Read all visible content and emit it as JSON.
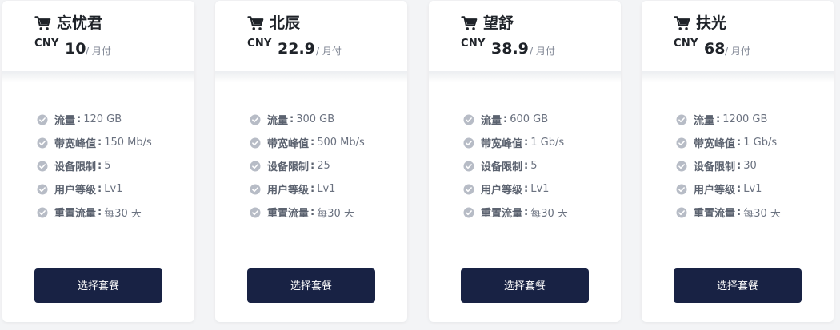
{
  "currency": "CNY",
  "period": "/ 月付",
  "button_label": "选择套餐",
  "feature_sep": ":",
  "colors": {
    "button_bg": "#182244",
    "page_bg": "#f3f4f6",
    "check_icon": "#b7bcc6"
  },
  "icons": {
    "cart": "shopping-cart-icon",
    "check": "check-circle-icon"
  },
  "plans": [
    {
      "name": "忘忧君",
      "price": "10",
      "features": [
        {
          "key": "流量",
          "value": "120 GB"
        },
        {
          "key": "带宽峰值",
          "value": "150 Mb/s"
        },
        {
          "key": "设备限制",
          "value": "5"
        },
        {
          "key": "用户等级",
          "value": "Lv1"
        },
        {
          "key": "重置流量",
          "value": "每30 天"
        }
      ]
    },
    {
      "name": "北辰",
      "price": "22.9",
      "features": [
        {
          "key": "流量",
          "value": "300 GB"
        },
        {
          "key": "带宽峰值",
          "value": "500 Mb/s"
        },
        {
          "key": "设备限制",
          "value": "25"
        },
        {
          "key": "用户等级",
          "value": "Lv1"
        },
        {
          "key": "重置流量",
          "value": "每30 天"
        }
      ]
    },
    {
      "name": "望舒",
      "price": "38.9",
      "features": [
        {
          "key": "流量",
          "value": "600 GB"
        },
        {
          "key": "带宽峰值",
          "value": "1 Gb/s"
        },
        {
          "key": "设备限制",
          "value": "5"
        },
        {
          "key": "用户等级",
          "value": "Lv1"
        },
        {
          "key": "重置流量",
          "value": "每30 天"
        }
      ]
    },
    {
      "name": "扶光",
      "price": "68",
      "features": [
        {
          "key": "流量",
          "value": "1200 GB"
        },
        {
          "key": "带宽峰值",
          "value": "1 Gb/s"
        },
        {
          "key": "设备限制",
          "value": "30"
        },
        {
          "key": "用户等级",
          "value": "Lv1"
        },
        {
          "key": "重置流量",
          "value": "每30 天"
        }
      ]
    }
  ]
}
